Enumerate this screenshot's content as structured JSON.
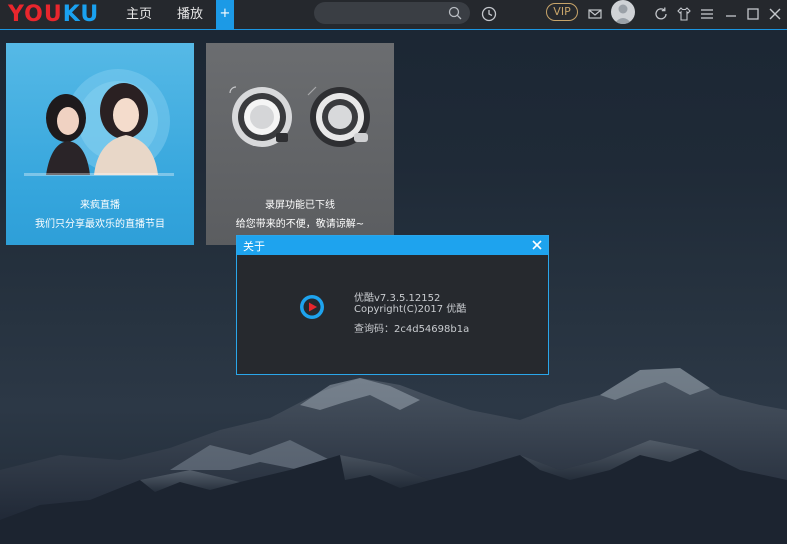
{
  "app": {
    "logo_text_red": "YOU",
    "logo_text_blue": "KU",
    "brand_red": "#e8262d",
    "brand_blue": "#1aa1f0",
    "accent": "#1ea3ee"
  },
  "nav": {
    "home_label": "主页",
    "play_label": "播放",
    "add_tab_label": "+"
  },
  "toolbar": {
    "search_placeholder": "",
    "vip_label": "VIP",
    "icons": [
      "search-icon",
      "history-icon",
      "mail-icon",
      "avatar",
      "refresh-icon",
      "skin-icon",
      "menu-icon",
      "minimize-icon",
      "maximize-icon",
      "close-icon"
    ]
  },
  "cards": {
    "live": {
      "title": "来疯直播",
      "subtitle": "我们只分享最欢乐的直播节目"
    },
    "record": {
      "title": "录屏功能已下线",
      "subtitle": "给您带来的不便，敬请谅解~"
    }
  },
  "about_dialog": {
    "title": "关于",
    "version": "优酷v7.3.5.12152",
    "copyright": "Copyright(C)2017 优酷",
    "query_code": "查询码：2c4d54698b1a"
  }
}
